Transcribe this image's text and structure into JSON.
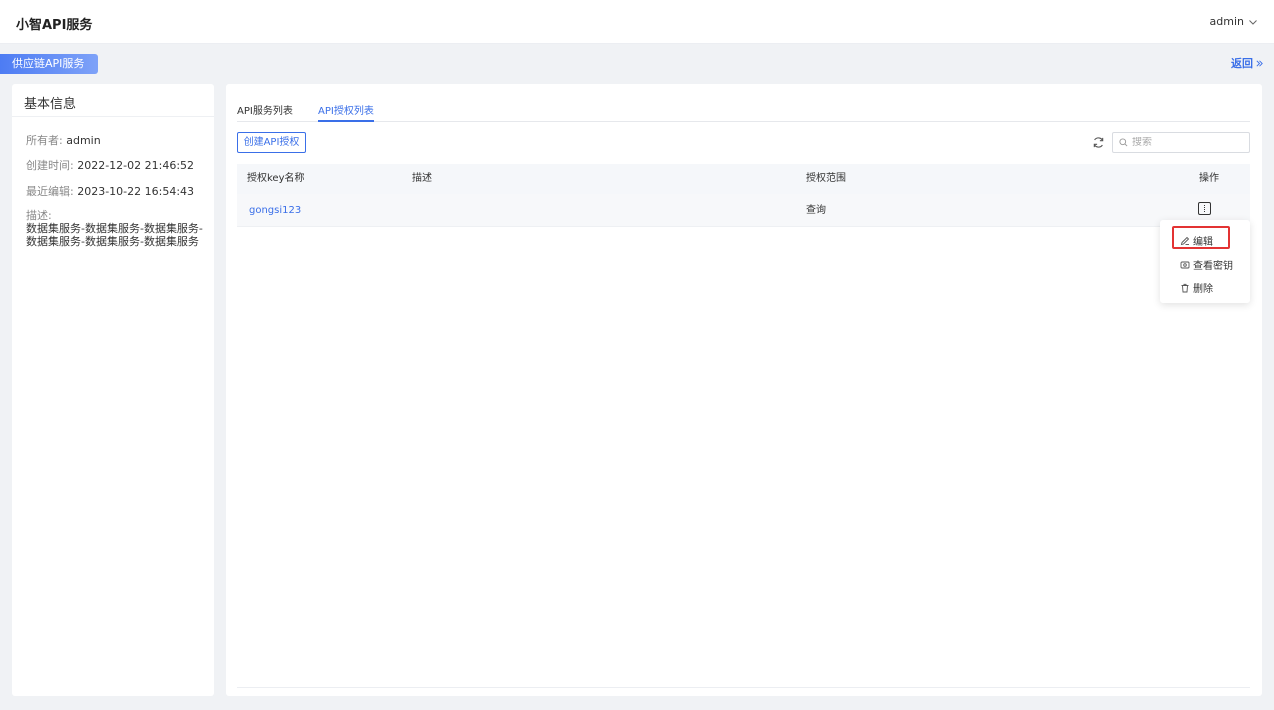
{
  "header": {
    "app_title": "小智API服务",
    "user": "admin"
  },
  "service": {
    "name": "供应链API服务",
    "back_label": "返回"
  },
  "basic_info": {
    "title": "基本信息",
    "owner_label": "所有者:",
    "owner": "admin",
    "created_label": "创建时间:",
    "created": "2022-12-02 21:46:52",
    "edited_label": "最近编辑:",
    "edited": "2023-10-22 16:54:43",
    "desc_label": "描述:",
    "desc": "数据集服务-数据集服务-数据集服务-数据集服务-数据集服务-数据集服务"
  },
  "tabs": [
    {
      "label": "API服务列表",
      "active": false
    },
    {
      "label": "API授权列表",
      "active": true
    }
  ],
  "toolbar": {
    "create_label": "创建API授权",
    "search_placeholder": "搜索"
  },
  "table": {
    "columns": [
      "授权key名称",
      "描述",
      "授权范围",
      "操作"
    ],
    "rows": [
      {
        "name": "gongsi123",
        "desc": "",
        "scope": "查询"
      }
    ]
  },
  "dropdown": {
    "items": [
      {
        "label": "编辑",
        "icon": "edit-icon"
      },
      {
        "label": "查看密钥",
        "icon": "key-view-icon"
      },
      {
        "label": "删除",
        "icon": "trash-icon"
      }
    ],
    "highlight_color": "#e33333"
  },
  "colors": {
    "accent": "#3a6fe8"
  }
}
